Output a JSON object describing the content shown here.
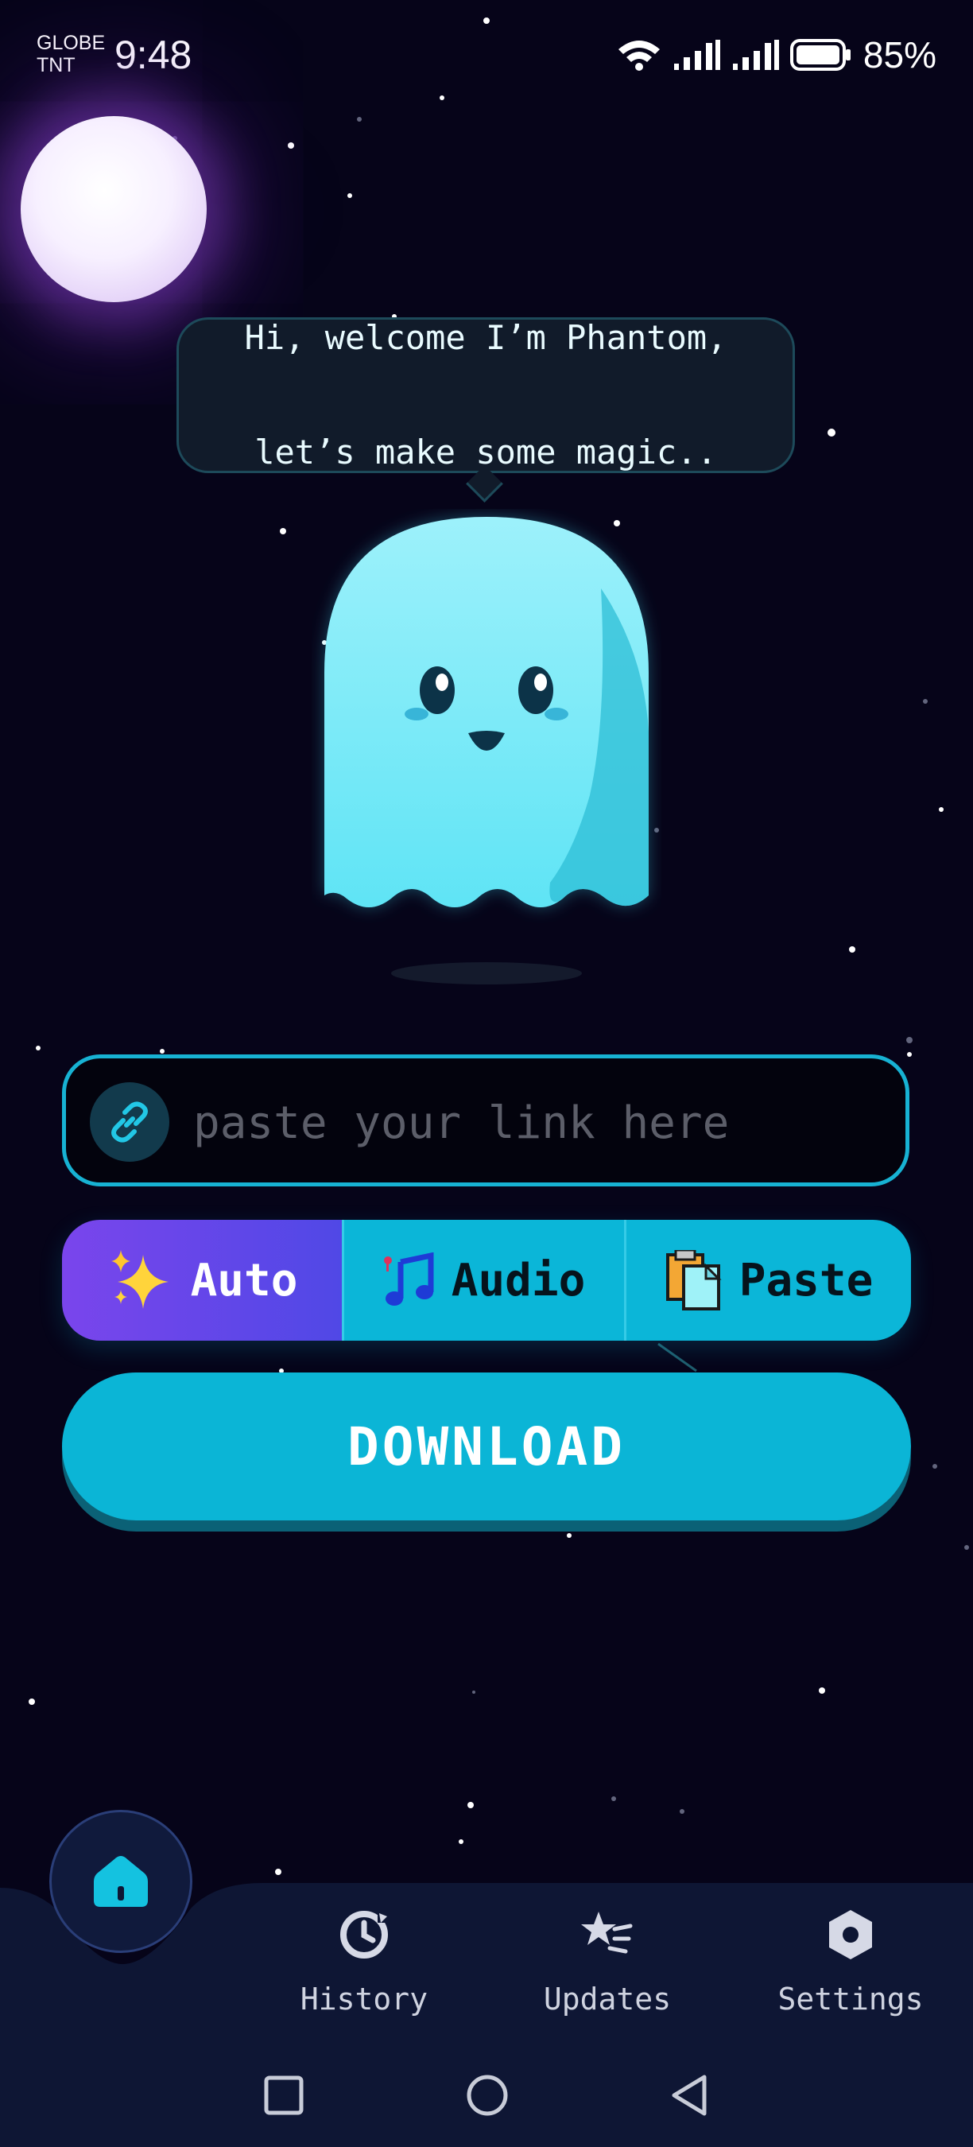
{
  "status_bar": {
    "carrier_line1": "GLOBE",
    "carrier_line2": "TNT",
    "time": "9:48",
    "battery": "85%",
    "icons": [
      "wifi-icon",
      "signal-icon",
      "signal-icon",
      "battery-icon"
    ]
  },
  "mascot": {
    "greeting_line1": "Hi, welcome I’m Phantom,",
    "greeting_line2": "let’s make some magic.."
  },
  "link_input": {
    "placeholder": "paste your link here",
    "value": "",
    "icon": "link-icon"
  },
  "modes": [
    {
      "label": "Auto",
      "icon": "sparkles-icon",
      "active": true
    },
    {
      "label": "Audio",
      "icon": "music-note-icon",
      "active": false
    },
    {
      "label": "Paste",
      "icon": "clipboard-icon",
      "active": false
    }
  ],
  "download_label": "DOWNLOAD",
  "bottom_nav": {
    "home_icon": "home-icon",
    "items": [
      {
        "label": "History",
        "icon": "history-icon"
      },
      {
        "label": "Updates",
        "icon": "updates-icon"
      },
      {
        "label": "Settings",
        "icon": "settings-icon"
      }
    ]
  },
  "colors": {
    "background": "#060419",
    "accent": "#0bb5d6",
    "auto_active": "#6a47eb",
    "ghost": "#7eeaf7"
  }
}
